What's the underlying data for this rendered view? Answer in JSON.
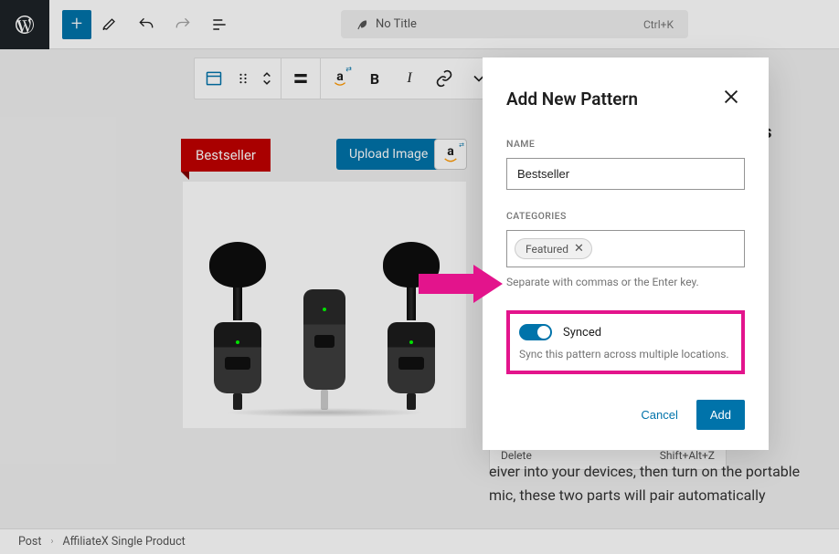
{
  "topbar": {
    "title": "No Title",
    "shortcut": "Ctrl+K"
  },
  "product": {
    "badge": "Bestseller",
    "upload_label": "Upload Image"
  },
  "content": {
    "heading_suffix": "ss",
    "paragraph_snippet": "eiver into your devices, then turn on the portable mic, these two parts will pair automatically",
    "delete_label": "Delete",
    "delete_shortcut": "Shift+Alt+Z"
  },
  "modal": {
    "title": "Add New Pattern",
    "name_label": "NAME",
    "name_value": "Bestseller",
    "categories_label": "CATEGORIES",
    "category_tag": "Featured",
    "categories_help": "Separate with commas or the Enter key.",
    "synced_label": "Synced",
    "synced_desc": "Sync this pattern across multiple locations.",
    "cancel_label": "Cancel",
    "add_label": "Add"
  },
  "breadcrumb": {
    "post": "Post",
    "block": "AffiliateX Single Product"
  }
}
